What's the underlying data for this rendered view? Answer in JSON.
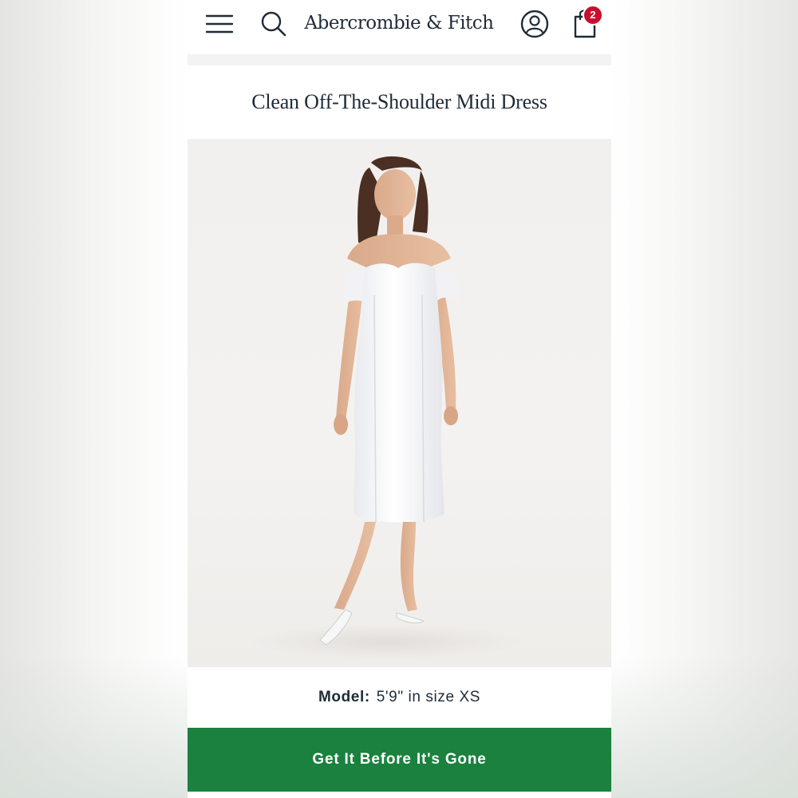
{
  "header": {
    "brand": "Abercrombie & Fitch",
    "cart_count": "2",
    "icons": [
      "menu-icon",
      "search-icon",
      "account-icon",
      "shopping-bag-icon"
    ]
  },
  "product": {
    "title": "Clean Off-The-Shoulder Midi Dress"
  },
  "model": {
    "label": "Model:",
    "value": "5'9\" in size XS"
  },
  "cta": {
    "label": "Get It Before It's Gone"
  },
  "colors": {
    "cta_green": "#1b813e",
    "badge_red": "#c8102e",
    "text_navy": "#1f2b38"
  }
}
